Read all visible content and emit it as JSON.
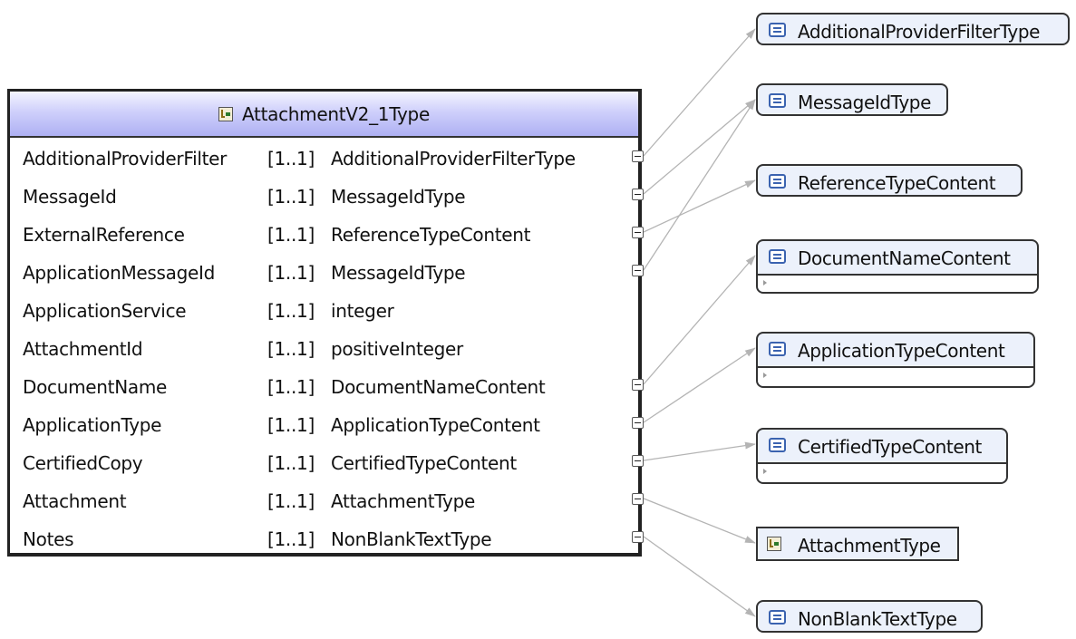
{
  "main_type": {
    "name": "AttachmentV2_1Type",
    "elements": [
      {
        "name": "AdditionalProviderFilter",
        "cardinality": "[1..1]",
        "type": "AdditionalProviderFilterType",
        "expandable": true
      },
      {
        "name": "MessageId",
        "cardinality": "[1..1]",
        "type": "MessageIdType",
        "expandable": true
      },
      {
        "name": "ExternalReference",
        "cardinality": "[1..1]",
        "type": "ReferenceTypeContent",
        "expandable": true
      },
      {
        "name": "ApplicationMessageId",
        "cardinality": "[1..1]",
        "type": "MessageIdType",
        "expandable": true
      },
      {
        "name": "ApplicationService",
        "cardinality": "[1..1]",
        "type": "integer",
        "expandable": false
      },
      {
        "name": "AttachmentId",
        "cardinality": "[1..1]",
        "type": "positiveInteger",
        "expandable": false
      },
      {
        "name": "DocumentName",
        "cardinality": "[1..1]",
        "type": "DocumentNameContent",
        "expandable": true
      },
      {
        "name": "ApplicationType",
        "cardinality": "[1..1]",
        "type": "ApplicationTypeContent",
        "expandable": true
      },
      {
        "name": "CertifiedCopy",
        "cardinality": "[1..1]",
        "type": "CertifiedTypeContent",
        "expandable": true
      },
      {
        "name": "Attachment",
        "cardinality": "[1..1]",
        "type": "AttachmentType",
        "expandable": true
      },
      {
        "name": "Notes",
        "cardinality": "[1..1]",
        "type": "NonBlankTextType",
        "expandable": true
      }
    ]
  },
  "referenced_types": [
    {
      "name": "AdditionalProviderFilterType",
      "kind": "simple",
      "has_content_row": false
    },
    {
      "name": "MessageIdType",
      "kind": "simple",
      "has_content_row": false
    },
    {
      "name": "ReferenceTypeContent",
      "kind": "simple",
      "has_content_row": false
    },
    {
      "name": "DocumentNameContent",
      "kind": "simple",
      "has_content_row": true
    },
    {
      "name": "ApplicationTypeContent",
      "kind": "simple",
      "has_content_row": true
    },
    {
      "name": "CertifiedTypeContent",
      "kind": "simple",
      "has_content_row": true
    },
    {
      "name": "AttachmentType",
      "kind": "complex",
      "has_content_row": false
    },
    {
      "name": "NonBlankTextType",
      "kind": "simple",
      "has_content_row": false
    }
  ],
  "colors": {
    "header_gradient_top": "#f4f4ff",
    "header_gradient_bottom": "#aeb0f3",
    "type_box_fill": "#ecf1fb",
    "connector": "#b4b4b4",
    "simple_type_icon": "#3b63b0"
  },
  "icons": {
    "complex_type": "complex-type-icon",
    "simple_type": "simple-type-icon",
    "expand_toggle": "collapse-toggle-icon"
  }
}
